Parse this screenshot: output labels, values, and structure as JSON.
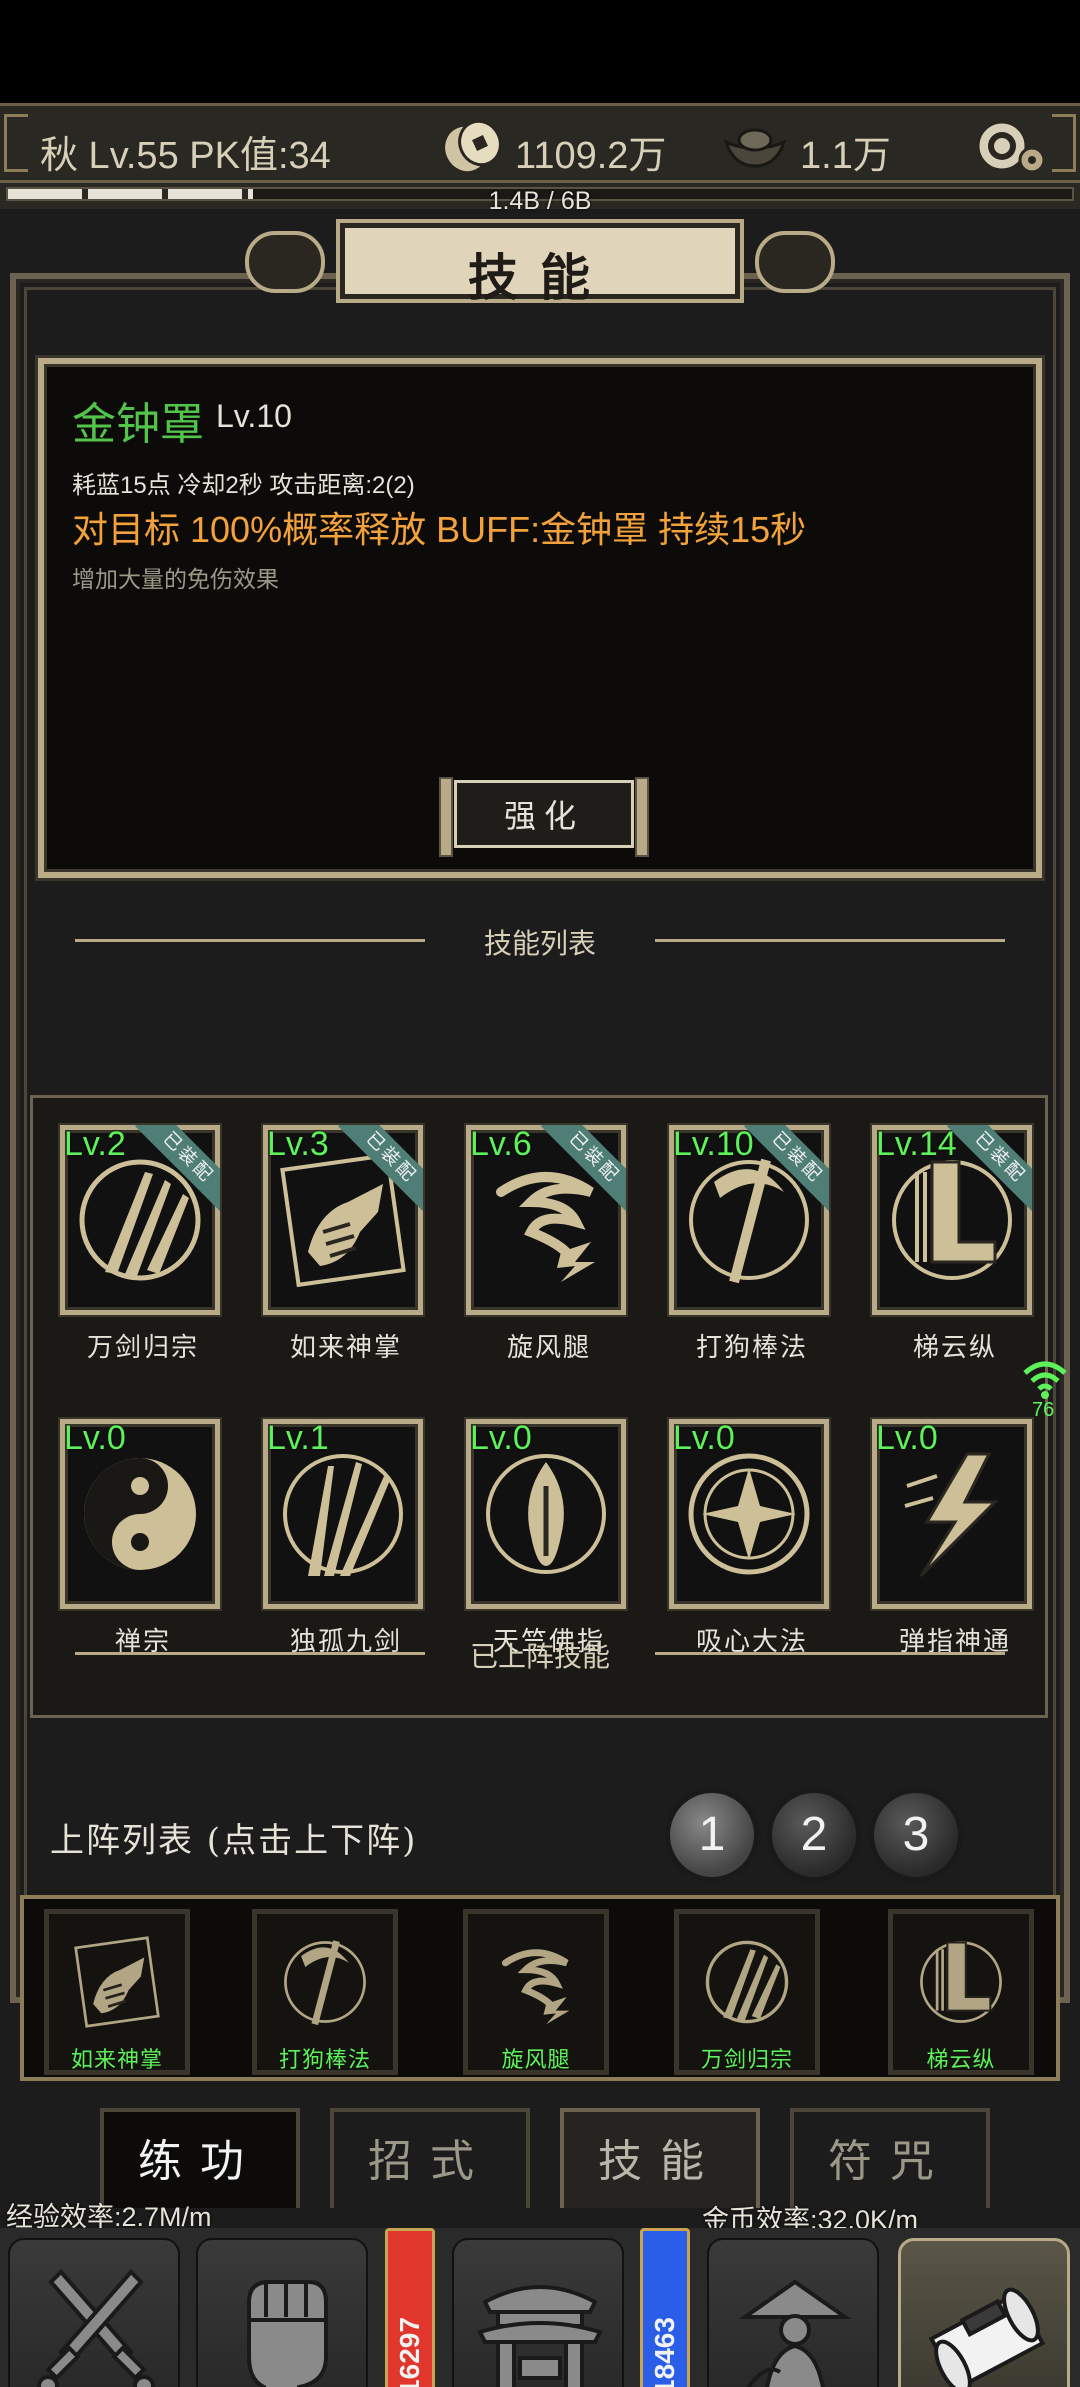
{
  "header": {
    "player_info": "秋  Lv.55 PK值:34",
    "coins": "1109.2万",
    "ingots": "1.1万",
    "storage": "1.4B / 6B",
    "storage_fraction": 0.23
  },
  "title": "技能",
  "detail": {
    "name": "金钟罩",
    "level": "Lv.10",
    "stats": "耗蓝15点 冷却2秒 攻击距离:2(2)",
    "effect": "对目标 100%概率释放 BUFF:金钟罩 持续15秒",
    "description": "增加大量的免伤效果",
    "enhance_label": "强化"
  },
  "skill_list_title": "技能列表",
  "skills": [
    {
      "level": "Lv.2",
      "name": "万剑归宗",
      "equipped": true,
      "tag": "已装配"
    },
    {
      "level": "Lv.3",
      "name": "如来神掌",
      "equipped": true,
      "tag": "已装配"
    },
    {
      "level": "Lv.6",
      "name": "旋风腿",
      "equipped": true,
      "tag": "已装配"
    },
    {
      "level": "Lv.10",
      "name": "打狗棒法",
      "equipped": true,
      "tag": "已装配"
    },
    {
      "level": "Lv.14",
      "name": "梯云纵",
      "equipped": true,
      "tag": "已装配"
    },
    {
      "level": "Lv.0",
      "name": "禅宗",
      "equipped": false
    },
    {
      "level": "Lv.1",
      "name": "独孤九剑",
      "equipped": false
    },
    {
      "level": "Lv.0",
      "name": "天竺佛指",
      "equipped": false
    },
    {
      "level": "Lv.0",
      "name": "吸心大法",
      "equipped": false
    },
    {
      "level": "Lv.0",
      "name": "弹指神通",
      "equipped": false
    }
  ],
  "wifi_value": "76",
  "lineup_title": "已上阵技能",
  "lineup_label": "上阵列表 (点击上下阵)",
  "pages": [
    "1",
    "2",
    "3"
  ],
  "lineup": [
    "如来神掌",
    "打狗棒法",
    "旋风腿",
    "万剑归宗",
    "梯云纵"
  ],
  "tabs": [
    "练功",
    "招式",
    "技能",
    "符咒"
  ],
  "rates": {
    "exp": "经验效率:2.7M/m",
    "gold": "金币效率:32.0K/m"
  },
  "nav": {
    "battle": "战斗",
    "character": "角色",
    "red_flag": "16297",
    "sect": "师门",
    "blue_flag": "18463",
    "wander": "闯荡",
    "practice": "练功"
  },
  "colors": {
    "accent_gold": "#b9ab88",
    "level_green": "#5df25a",
    "effect_orange": "#f3a13a",
    "equipped_ribbon": "#4f7e77"
  }
}
